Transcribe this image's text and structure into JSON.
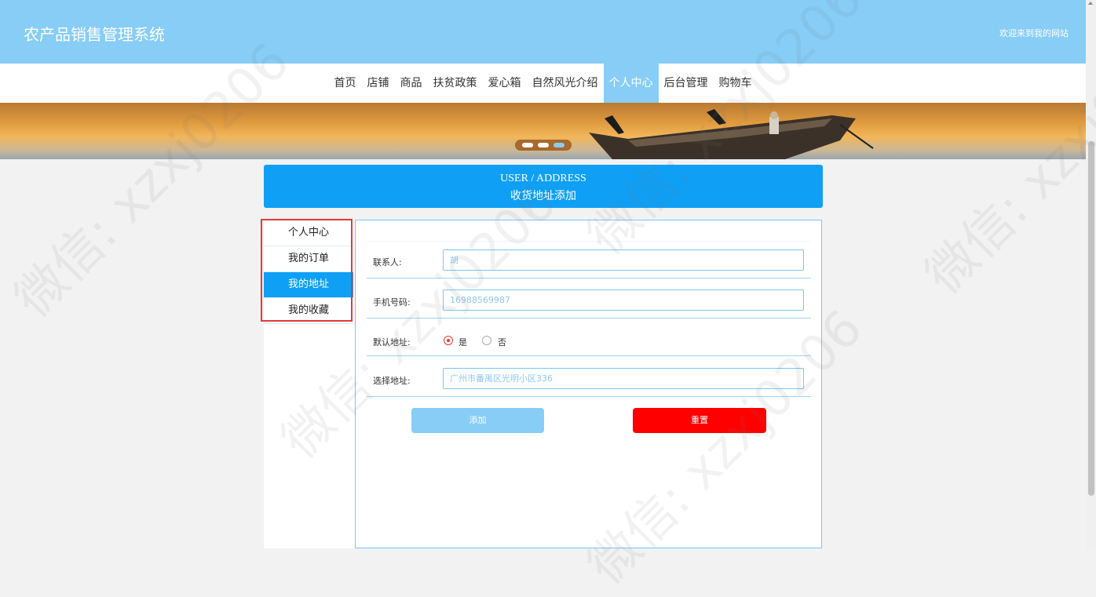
{
  "header": {
    "brand": "农产品销售管理系统",
    "welcome": "欢迎来到我的网站"
  },
  "nav": {
    "items": [
      "首页",
      "店铺",
      "商品",
      "扶贫政策",
      "爱心箱",
      "自然风光介绍",
      "个人中心",
      "后台管理",
      "购物车"
    ],
    "active": "个人中心"
  },
  "title_bar": {
    "en": "USER / ADDRESS",
    "cn": "收货地址添加"
  },
  "sidebar": {
    "items": [
      "个人中心",
      "我的订单",
      "我的地址",
      "我的收藏"
    ],
    "active": "我的地址"
  },
  "form": {
    "contact_label": "联系人:",
    "contact_value": "胡",
    "phone_label": "手机号码:",
    "phone_value": "16988569987",
    "default_label": "默认地址:",
    "default_yes": "是",
    "default_no": "否",
    "default_selected": "是",
    "address_label": "选择地址:",
    "address_value": "广州市番禺区光明小区336",
    "add_button": "添加",
    "reset_button": "重置"
  },
  "watermark": "微信: xzxj0206",
  "colors": {
    "header": "#87cdf6",
    "accent": "#0fa0f5",
    "reset": "#ff0000"
  }
}
